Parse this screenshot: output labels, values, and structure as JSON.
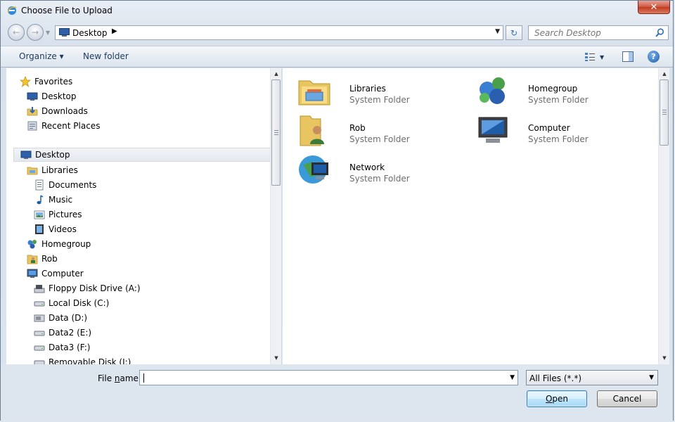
{
  "window": {
    "title": "Choose File to Upload",
    "close_glyph": "✕"
  },
  "nav": {
    "back_glyph": "←",
    "forward_glyph": "→",
    "address": {
      "location": "Desktop",
      "separator": "▶",
      "dropdown": "▼"
    },
    "refresh_glyph": "↻",
    "search": {
      "placeholder": "Search Desktop"
    }
  },
  "toolbar": {
    "organize_label": "Organize ▾",
    "new_folder_label": "New folder",
    "view_caret": "▼",
    "help_glyph": "?"
  },
  "sidebar": {
    "favorites": {
      "label": "Favorites",
      "items": [
        {
          "label": "Desktop",
          "icon": "desktop-icon"
        },
        {
          "label": "Downloads",
          "icon": "downloads-icon"
        },
        {
          "label": "Recent Places",
          "icon": "recent-places-icon"
        }
      ]
    },
    "desktop": {
      "label": "Desktop"
    },
    "libraries": {
      "label": "Libraries",
      "items": [
        {
          "label": "Documents",
          "icon": "documents-icon"
        },
        {
          "label": "Music",
          "icon": "music-icon"
        },
        {
          "label": "Pictures",
          "icon": "pictures-icon"
        },
        {
          "label": "Videos",
          "icon": "videos-icon"
        }
      ]
    },
    "homegroup": {
      "label": "Homegroup"
    },
    "rob": {
      "label": "Rob"
    },
    "computer": {
      "label": "Computer",
      "items": [
        {
          "label": "Floppy Disk Drive (A:)",
          "icon": "floppy-drive-icon"
        },
        {
          "label": "Local Disk (C:)",
          "icon": "local-disk-icon"
        },
        {
          "label": "Data (D:)",
          "icon": "data-drive-icon"
        },
        {
          "label": "Data2 (E:)",
          "icon": "data2-drive-icon"
        },
        {
          "label": "Data3 (F:)",
          "icon": "data3-drive-icon"
        },
        {
          "label": "Removable Disk (I:)",
          "icon": "removable-disk-icon"
        }
      ]
    }
  },
  "content": {
    "items": [
      {
        "name": "Libraries",
        "type": "System Folder",
        "icon": "libraries-folder-icon"
      },
      {
        "name": "Homegroup",
        "type": "System Folder",
        "icon": "homegroup-icon"
      },
      {
        "name": "Rob",
        "type": "System Folder",
        "icon": "user-folder-icon"
      },
      {
        "name": "Computer",
        "type": "System Folder",
        "icon": "computer-icon"
      },
      {
        "name": "Network",
        "type": "System Folder",
        "icon": "network-icon"
      }
    ]
  },
  "footer": {
    "file_name_label_prefix": "File ",
    "file_name_label_hotkey": "n",
    "file_name_label_suffix": "ame:",
    "file_name_value": "",
    "file_name_dropdown": "▼",
    "filter_value": "All Files (*.*)",
    "filter_dropdown": "▼",
    "open_hotkey": "O",
    "open_rest": "pen",
    "cancel_label": "Cancel"
  },
  "scroll_glyphs": {
    "up": "▲",
    "down": "▼"
  }
}
